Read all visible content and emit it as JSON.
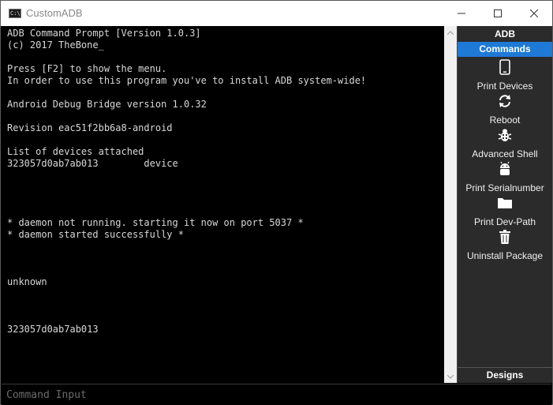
{
  "window": {
    "title": "CustomADB",
    "icon_glyph": "C:\\"
  },
  "console": {
    "lines": [
      "ADB Command Prompt [Version 1.0.3]",
      "(c) 2017 TheBone_",
      "",
      "Press [F2] to show the menu.",
      "In order to use this program you've to install ADB system-wide!",
      "",
      "Android Debug Bridge version 1.0.32",
      "",
      "Revision eac51f2bb6a8-android",
      "",
      "List of devices attached",
      "323057d0ab7ab013        device",
      "",
      "",
      "",
      "",
      "* daemon not running. starting it now on port 5037 *",
      "* daemon started successfully *",
      "",
      "",
      "",
      "unknown",
      "",
      "",
      "",
      "323057d0ab7ab013"
    ]
  },
  "panel": {
    "header": "ADB",
    "commands_tab": "Commands",
    "designs_tab": "Designs",
    "commands": [
      {
        "label": "Print Devices",
        "icon": "mobile-phone-icon"
      },
      {
        "label": "Reboot",
        "icon": "refresh-icon"
      },
      {
        "label": "Advanced Shell",
        "icon": "bug-icon"
      },
      {
        "label": "Print Serialnumber",
        "icon": "android-icon"
      },
      {
        "label": "Print Dev-Path",
        "icon": "folder-icon"
      },
      {
        "label": "Uninstall Package",
        "icon": "trash-icon"
      }
    ]
  },
  "input": {
    "placeholder": "Command Input",
    "value": ""
  },
  "colors": {
    "console_bg": "#000000",
    "console_text": "#d8d8d8",
    "panel_bg": "#2b2b2b",
    "accent": "#1e7ad6"
  }
}
